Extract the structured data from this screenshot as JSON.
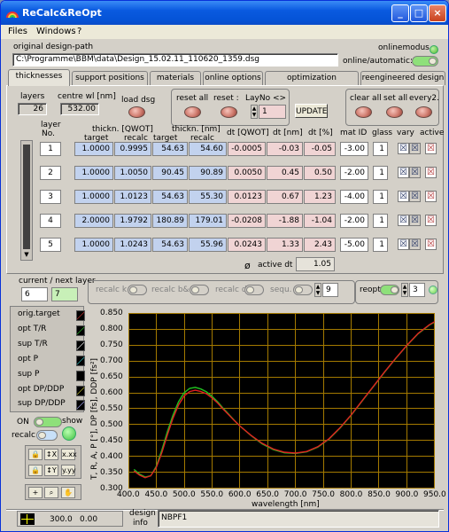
{
  "window": {
    "title": "ReCalc&ReOpt",
    "min": "_",
    "max": "□",
    "close": "×"
  },
  "menu": [
    "Files",
    "Windows",
    "?"
  ],
  "path": {
    "label": "original design-path",
    "value": "C:\\Programme\\BBM\\data\\Design_15.02.11_110620_1359.dsg"
  },
  "online": {
    "label": "onlinemodus",
    "auto_label": "online/automatic:"
  },
  "tabs": [
    "thicknesses",
    "support positions",
    "materials",
    "online options",
    "optimization parameter",
    "reengineered design"
  ],
  "controls": {
    "layers_label": "layers",
    "layers_value": "26",
    "centre_label": "centre wl [nm]",
    "centre_value": "532.00",
    "load_label": "load dsg",
    "reset_all_label": "reset all",
    "reset_label": "reset :",
    "layno_label": "LayNo <>",
    "layno_value": "1",
    "update_label": "UPDATE",
    "clear_all_label": "clear all",
    "set_all_label": "set all",
    "every2_label": "every2."
  },
  "table": {
    "hdr_layer": "layer",
    "hdr_no": "No.",
    "hdr_thickn_qwot": "thickn. [QWOT]",
    "hdr_target1": "target",
    "hdr_recalc1": "recalc",
    "hdr_thickn_nm": "thickn. [nm]",
    "hdr_target2": "target",
    "hdr_recalc2": "recalc",
    "hdr_dt_qwot": "dt [QWOT]",
    "hdr_dt_nm": "dt [nm]",
    "hdr_dt_pct": "dt [%]",
    "hdr_mat": "mat ID",
    "hdr_glass": "glass",
    "hdr_vary": "vary",
    "hdr_active": "active",
    "rows": [
      {
        "no": "1",
        "tq": "1.0000",
        "rq": "0.9995",
        "tn": "54.63",
        "rn": "54.60",
        "dq": "-0.0005",
        "dn": "-0.03",
        "dp": "-0.05",
        "mat": "-3.00",
        "glass": "1"
      },
      {
        "no": "2",
        "tq": "1.0000",
        "rq": "1.0050",
        "tn": "90.45",
        "rn": "90.89",
        "dq": "0.0050",
        "dn": "0.45",
        "dp": "0.50",
        "mat": "-2.00",
        "glass": "1"
      },
      {
        "no": "3",
        "tq": "1.0000",
        "rq": "1.0123",
        "tn": "54.63",
        "rn": "55.30",
        "dq": "0.0123",
        "dn": "0.67",
        "dp": "1.23",
        "mat": "-4.00",
        "glass": "1"
      },
      {
        "no": "4",
        "tq": "2.0000",
        "rq": "1.9792",
        "tn": "180.89",
        "rn": "179.01",
        "dq": "-0.0208",
        "dn": "-1.88",
        "dp": "-1.04",
        "mat": "-2.00",
        "glass": "1"
      },
      {
        "no": "5",
        "tq": "1.0000",
        "rq": "1.0243",
        "tn": "54.63",
        "rn": "55.96",
        "dq": "0.0243",
        "dn": "1.33",
        "dp": "2.43",
        "mat": "-5.00",
        "glass": "1"
      }
    ],
    "avg_symbol": "ø",
    "active_dt_label": "active dt",
    "active_dt_value": "1.05"
  },
  "layerbar": {
    "label": "current / next layer",
    "current": "6",
    "next": "7",
    "recalc_k": "recalc k",
    "recalc_bc": "recalc b&c",
    "recalc_d": "recalc d",
    "sequ": "sequ.",
    "sequ_value": "9",
    "reopt": "reopt",
    "reopt_value": "3"
  },
  "legend": [
    "orig.target",
    "opt T/R",
    "sup T/R",
    "opt P",
    "sup P",
    "opt DP/DDP",
    "sup DP/DDP"
  ],
  "legend_controls": {
    "on_label": "ON",
    "show_label": "show",
    "recalc_label": "recalc"
  },
  "chart_data": {
    "type": "line",
    "xlabel": "wavelength [nm]",
    "ylabel": "T, R, A, P [°], DP [fs], DDP [fs²]",
    "xlim": [
      400,
      950
    ],
    "ylim": [
      0.3,
      0.85
    ],
    "x_ticks": [
      "400.0",
      "450.0",
      "500.0",
      "550.0",
      "600.0",
      "650.0",
      "700.0",
      "750.0",
      "800.0",
      "850.0",
      "900.0",
      "950.0"
    ],
    "y_ticks": [
      "0.850",
      "0.800",
      "0.750",
      "0.700",
      "0.650",
      "0.600",
      "0.550",
      "0.500",
      "0.450",
      "0.400",
      "0.350",
      "0.300"
    ],
    "series": [
      {
        "color": "#20c020",
        "x": [
          410,
          420,
          430,
          440,
          450,
          460,
          470,
          480,
          490,
          500,
          510,
          520,
          530,
          540,
          550,
          560,
          570,
          580,
          590,
          600,
          620,
          640,
          660,
          680,
          700,
          720,
          740,
          760,
          780,
          800,
          820,
          840,
          860,
          880,
          900,
          920,
          940,
          950
        ],
        "values": [
          0.36,
          0.345,
          0.336,
          0.34,
          0.37,
          0.42,
          0.478,
          0.53,
          0.572,
          0.6,
          0.614,
          0.617,
          0.612,
          0.603,
          0.589,
          0.572,
          0.552,
          0.533,
          0.514,
          0.496,
          0.466,
          0.44,
          0.422,
          0.412,
          0.41,
          0.415,
          0.43,
          0.455,
          0.49,
          0.53,
          0.575,
          0.62,
          0.665,
          0.708,
          0.748,
          0.785,
          0.812,
          0.822
        ]
      },
      {
        "color": "#e02020",
        "x": [
          410,
          420,
          430,
          440,
          450,
          460,
          470,
          480,
          490,
          500,
          510,
          520,
          530,
          540,
          550,
          560,
          570,
          580,
          590,
          600,
          620,
          640,
          660,
          680,
          700,
          720,
          740,
          760,
          780,
          800,
          820,
          840,
          860,
          880,
          900,
          920,
          940,
          950
        ],
        "values": [
          0.355,
          0.342,
          0.334,
          0.34,
          0.366,
          0.412,
          0.468,
          0.52,
          0.562,
          0.59,
          0.604,
          0.608,
          0.604,
          0.597,
          0.584,
          0.568,
          0.549,
          0.531,
          0.513,
          0.496,
          0.467,
          0.442,
          0.424,
          0.414,
          0.411,
          0.416,
          0.431,
          0.456,
          0.491,
          0.531,
          0.576,
          0.621,
          0.666,
          0.709,
          0.749,
          0.786,
          0.813,
          0.823
        ]
      }
    ]
  },
  "status": {
    "coords_x": "300.0",
    "coords_y": "0.00",
    "design_label1": "design",
    "design_label2": "info",
    "design_value": "NBPF1"
  }
}
